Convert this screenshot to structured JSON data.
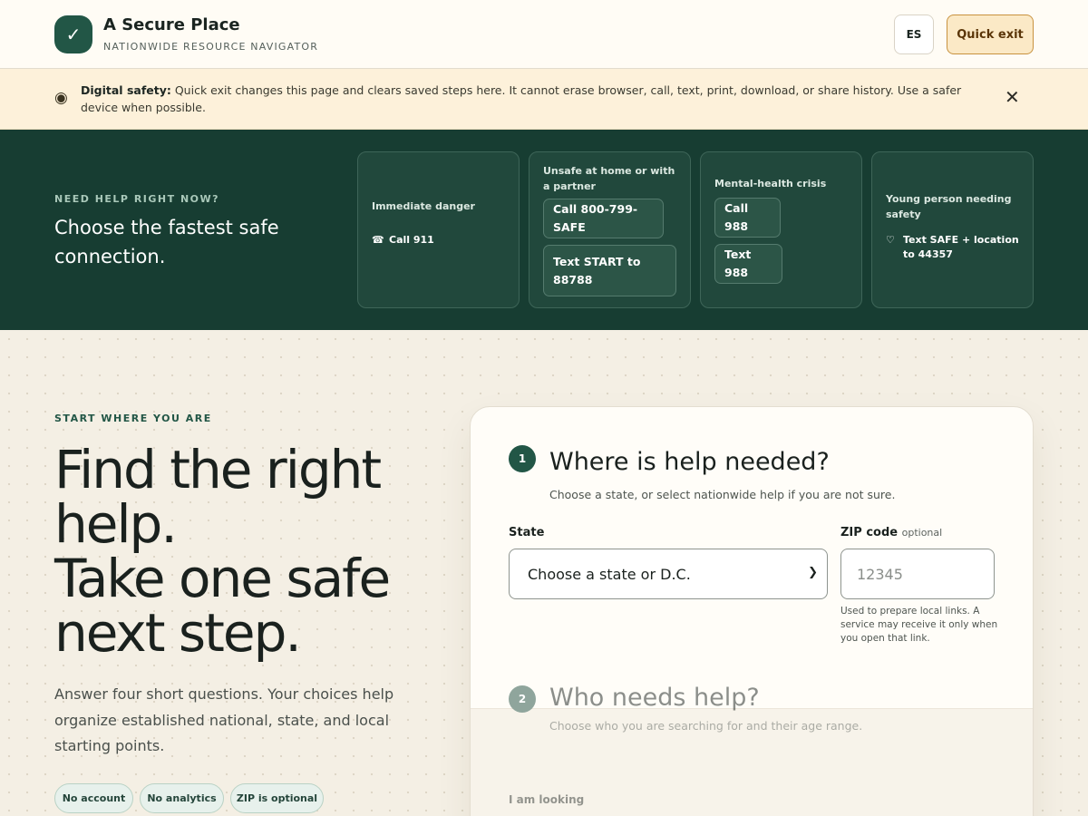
{
  "header": {
    "logo_glyph": "✓",
    "title": "A Secure Place",
    "subtitle": "NATIONWIDE RESOURCE NAVIGATOR",
    "lang_button": "ES",
    "exit_button": "Quick exit"
  },
  "banner": {
    "icon": "◉",
    "lead": "Digital safety:",
    "text": " Quick exit changes this page and clears saved steps here. It cannot erase browser, call, text, print, download, or share history. Use a safer device when possible.",
    "close": "✕"
  },
  "emergency": {
    "eyebrow": "NEED HELP RIGHT NOW?",
    "title": "Choose the fastest safe connection.",
    "cards": [
      {
        "title": "Immediate danger",
        "link_icon": "☎",
        "link": "Call 911"
      },
      {
        "title": "Unsafe at home or with a partner",
        "btn1": "Call 800-799-SAFE",
        "btn2": "Text START to 88788"
      },
      {
        "title": "Mental-health crisis",
        "btn1": "Call 988",
        "btn2": "Text 988"
      },
      {
        "title": "Young person needing safety",
        "link_icon": "♡",
        "link": "Text SAFE + location to 44357"
      }
    ]
  },
  "hero": {
    "eyebrow": "START WHERE YOU ARE",
    "line1": "Find the right",
    "line2": "help.",
    "line3": "Take one safe",
    "line4": "next step.",
    "lede": "Answer four short questions. Your choices help organize established national, state, and local starting points.",
    "chips": [
      "No account",
      "No analytics",
      "ZIP is optional"
    ]
  },
  "form": {
    "step1": {
      "number": "1",
      "title": "Where is help needed?",
      "subtitle": "Choose a state, or select nationwide help if you are not sure.",
      "state_label": "State",
      "state_value": "Choose a state or D.C.",
      "zip_label": "ZIP code",
      "zip_optional": "optional",
      "zip_placeholder": "12345",
      "zip_help": "Used to prepare local links. A service may receive it only when you open that link."
    },
    "step2": {
      "number": "2",
      "title": "Who needs help?",
      "subtitle": "Choose who you are searching for and their age range.",
      "looking_label": "I am looking"
    }
  },
  "colors": {
    "brand_green": "#225646",
    "dark_strip": "#173d32",
    "banner_bg": "#fdf1da",
    "exit_bg": "#fbe9c6",
    "step2_badge": "#8fa59c"
  }
}
